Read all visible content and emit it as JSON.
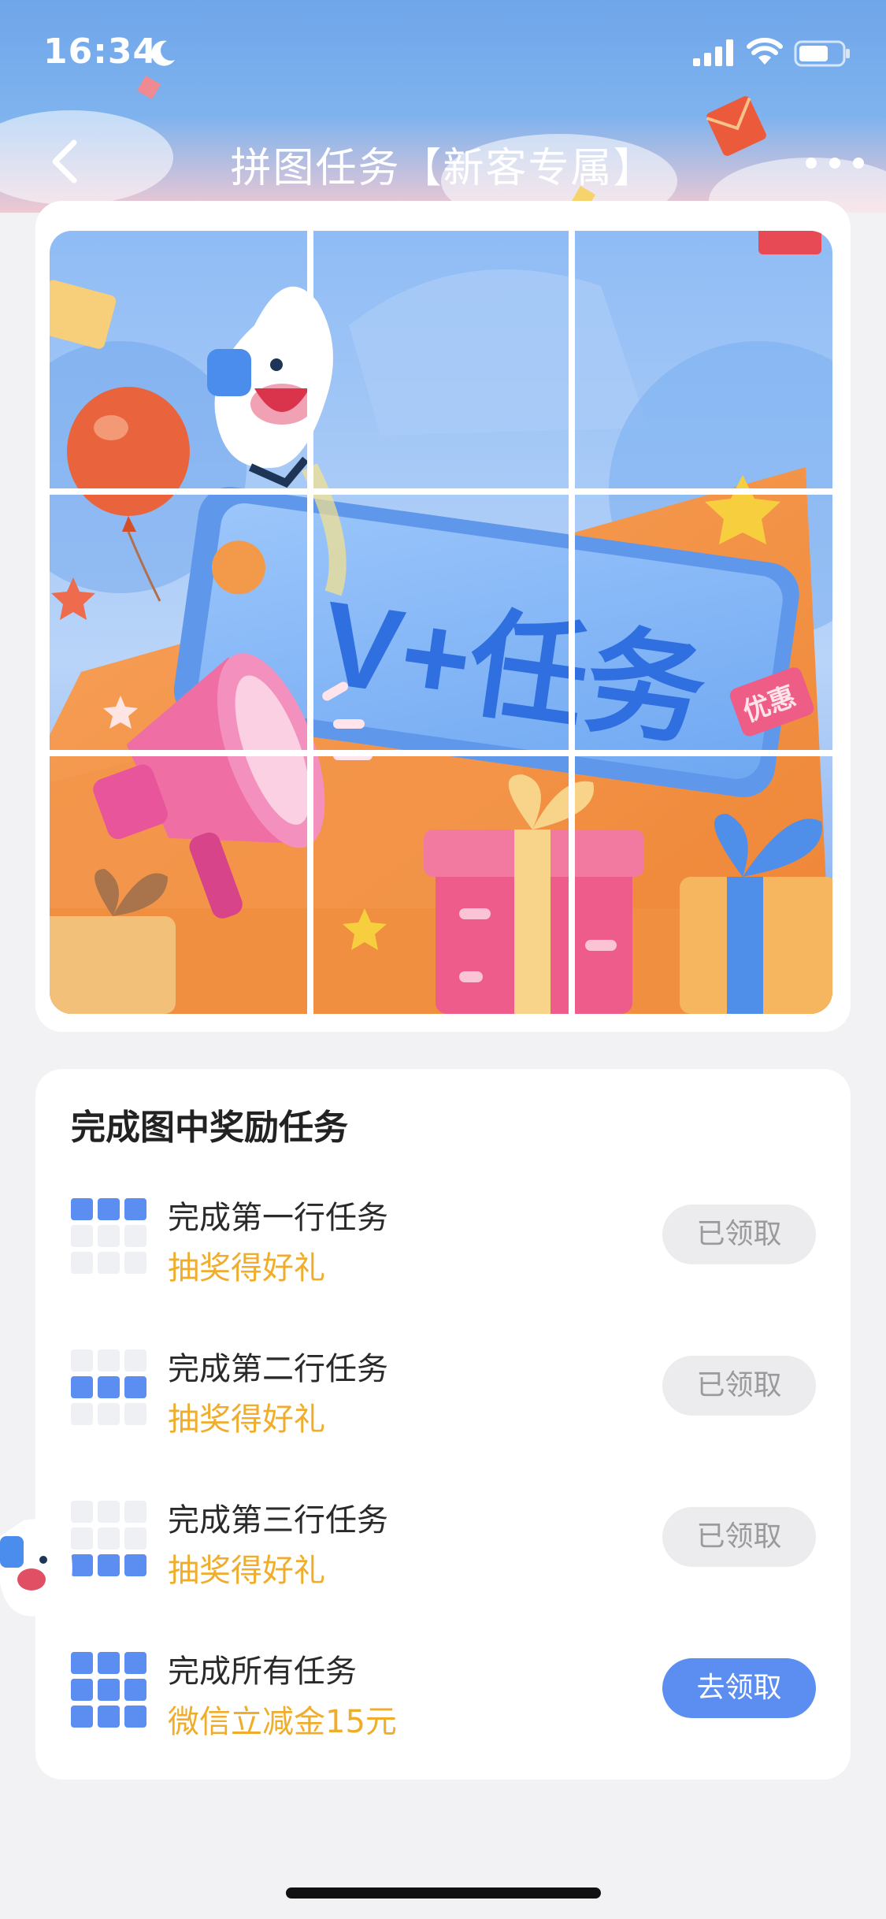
{
  "status_bar": {
    "time": "16:34",
    "icons": [
      "moon-icon",
      "signal-icon",
      "wifi-icon",
      "battery-icon"
    ]
  },
  "nav": {
    "title": "拼图任务【新客专属】",
    "back_icon": "chevron-left-icon",
    "more_icon": "more-icon"
  },
  "puzzle": {
    "main_text": "V+任务",
    "badge_text": "优惠",
    "grid": "3x3"
  },
  "tasks": {
    "title": "完成图中奖励任务",
    "items": [
      {
        "name": "完成第一行任务",
        "reward": "抽奖得好礼",
        "button": "已领取",
        "highlight_rows": [
          0
        ],
        "claimed": true
      },
      {
        "name": "完成第二行任务",
        "reward": "抽奖得好礼",
        "button": "已领取",
        "highlight_rows": [
          1
        ],
        "claimed": true
      },
      {
        "name": "完成第三行任务",
        "reward": "抽奖得好礼",
        "button": "已领取",
        "highlight_rows": [
          2
        ],
        "claimed": true
      },
      {
        "name": "完成所有任务",
        "reward": "微信立减金15元",
        "button": "去领取",
        "highlight_rows": [
          0,
          1,
          2
        ],
        "claimed": false
      }
    ]
  },
  "colors": {
    "accent": "#5b8ef0",
    "reward": "#f0ad2c",
    "cell_active": "#5b8ef0",
    "cell_inactive": "#eef0f3",
    "btn_claimed_bg": "#ececee",
    "btn_claimed_text": "#9a9a9e"
  }
}
